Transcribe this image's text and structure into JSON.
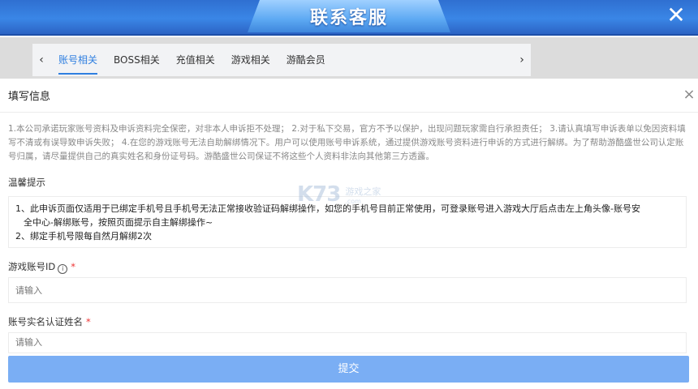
{
  "header": {
    "title": "联系客服",
    "close_glyph": "✕"
  },
  "tabs": {
    "prev_glyph": "‹",
    "next_glyph": "›",
    "items": [
      {
        "label": "账号相关",
        "active": true
      },
      {
        "label": "BOSS相关",
        "active": false
      },
      {
        "label": "充值相关",
        "active": false
      },
      {
        "label": "游戏相关",
        "active": false
      },
      {
        "label": "游酷会员",
        "active": false
      }
    ]
  },
  "modal": {
    "title": "填写信息",
    "close_glyph": "×",
    "notice": "1.本公司承诺玩家账号资料及申诉资料完全保密，对非本人申诉拒不处理； 2.对于私下交易，官方不予以保护，出现问题玩家需自行承担责任； 3.请认真填写申诉表单以免因资料填写不清或有误导致申诉失败； 4.在您的游戏账号无法自助解绑情况下。用户可以使用账号申诉系统，通过提供游戏账号资料进行申诉的方式进行解绑。为了帮助游酷盛世公司认定账号归属，请尽量提供自己的真实姓名和身份证号码。游酷盛世公司保证不将这些个人资料非法向其他第三方透露。",
    "tips_label": "温馨提示",
    "tips": [
      "1、此申诉页面仅适用于已绑定手机号且手机号无法正常接收验证码解绑操作，如您的手机号目前正常使用，可登录账号进入游戏大厅后点击左上角头像-账号安",
      "全中心-解绑账号，按照页面提示自主解绑操作~",
      "2、绑定手机号限每自然月解绑2次"
    ],
    "fields": {
      "account_id": {
        "label": "游戏账号ID",
        "required_mark": "*",
        "info_glyph": "i",
        "placeholder": "请输入"
      },
      "real_name": {
        "label": "账号实名认证姓名",
        "required_mark": "*",
        "placeholder": "请输入"
      }
    },
    "submit_label": "提交"
  },
  "watermark": {
    "logo": "K73",
    "cn": "游戏之家",
    "en": ".com"
  },
  "colors": {
    "accent": "#2f7fe0",
    "submit": "#7aaef4",
    "required": "#e33333"
  }
}
